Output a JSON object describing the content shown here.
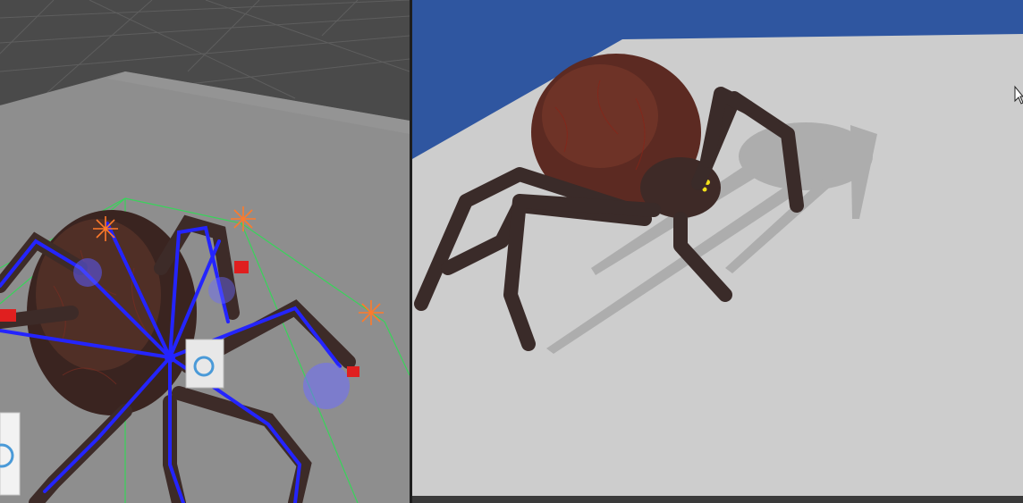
{
  "app": {
    "title": "",
    "panels": [
      {
        "id": "scene-view",
        "kind": "editor-viewport",
        "subject": "spider-rig"
      },
      {
        "id": "game-view",
        "kind": "rendered-preview",
        "subject": "spider"
      }
    ]
  },
  "colors": {
    "scene_floor": "#8c8c8c",
    "scene_background": "#4a4a4a",
    "bones": "#2424ff",
    "bounds": "#38d45a",
    "ik_handle": "#e01f1f",
    "pivot": "#ff7a2a",
    "game_sky": "#2f56a0",
    "game_floor": "#cfcfcf",
    "spider_body": "#5c2a22",
    "spider_eyes": "#f2e21a"
  },
  "icons": {
    "gizmo": "rotate-gizmo-icon",
    "cursor": "mouse-pointer-icon"
  }
}
